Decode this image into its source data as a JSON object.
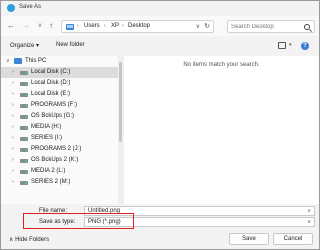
{
  "window": {
    "title": "Save As"
  },
  "address": {
    "crumbs": [
      "Users",
      "XP",
      "Desktop"
    ],
    "search_placeholder": "Search Desktop"
  },
  "toolbar": {
    "organize_label": "Organize ▾",
    "new_folder_label": "New folder"
  },
  "nav_pane": {
    "items": [
      {
        "label": "This PC",
        "icon": "computer-icon",
        "expanded": true
      },
      {
        "label": "Local Disk (C:)",
        "icon": "drive-icon",
        "selected": true
      },
      {
        "label": "Local Disk (D:)",
        "icon": "drive-icon"
      },
      {
        "label": "Local Disk (E:)",
        "icon": "drive-icon"
      },
      {
        "label": "PROGRAMS (F:)",
        "icon": "drive-icon"
      },
      {
        "label": "OS BckUps (G:)",
        "icon": "drive-icon"
      },
      {
        "label": "MEDIA (H:)",
        "icon": "drive-icon"
      },
      {
        "label": "SERIES (I:)",
        "icon": "drive-icon"
      },
      {
        "label": "PROGRAMS 2 (J:)",
        "icon": "drive-icon"
      },
      {
        "label": "OS BckUps 2 (K:)",
        "icon": "drive-icon"
      },
      {
        "label": "MEDIA 2 (L:)",
        "icon": "drive-icon"
      },
      {
        "label": "SERIES 2 (M:)",
        "icon": "drive-icon"
      }
    ]
  },
  "content": {
    "empty_message": "No items match your search."
  },
  "form": {
    "file_name_label": "File name:",
    "file_name_value": "Untitled.png",
    "save_type_label": "Save as type:",
    "save_type_value": "PNG (*.png)"
  },
  "footer": {
    "hide_folders_label": "Hide Folders",
    "save_label": "Save",
    "cancel_label": "Cancel"
  },
  "colors": {
    "accent": "#3a86d4",
    "highlight": "#e02020",
    "selected_row": "#dcdcdc"
  }
}
